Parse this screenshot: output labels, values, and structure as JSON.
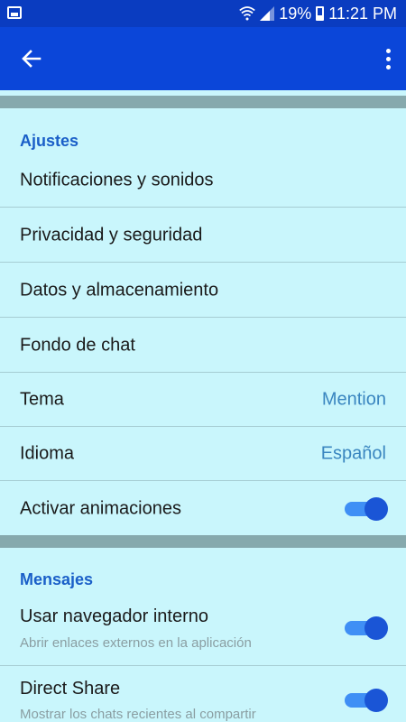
{
  "status_bar": {
    "battery": "19%",
    "time": "11:21 PM"
  },
  "app_bar": {
    "back_icon": "arrow-left-icon",
    "more_icon": "more-vert-icon"
  },
  "sections": [
    {
      "title": "Ajustes",
      "items": [
        {
          "label": "Notificaciones y sonidos"
        },
        {
          "label": "Privacidad y seguridad"
        },
        {
          "label": "Datos y almacenamiento"
        },
        {
          "label": "Fondo de chat"
        },
        {
          "label": "Tema",
          "value": "Mention"
        },
        {
          "label": "Idioma",
          "value": "Español"
        },
        {
          "label": "Activar animaciones",
          "toggle": true
        }
      ]
    },
    {
      "title": "Mensajes",
      "items": [
        {
          "label": "Usar navegador interno",
          "subtitle": "Abrir enlaces externos en la aplicación",
          "toggle": true
        },
        {
          "label": "Direct Share",
          "subtitle": "Mostrar los chats recientes al compartir",
          "toggle": true
        }
      ]
    }
  ],
  "colors": {
    "status_bar": "#0a3cc0",
    "app_bar": "#0b46d9",
    "background": "#c9f6fc",
    "section_title": "#1a5fc8",
    "value_text": "#3a86c0",
    "toggle_on": "#1a55d6"
  }
}
